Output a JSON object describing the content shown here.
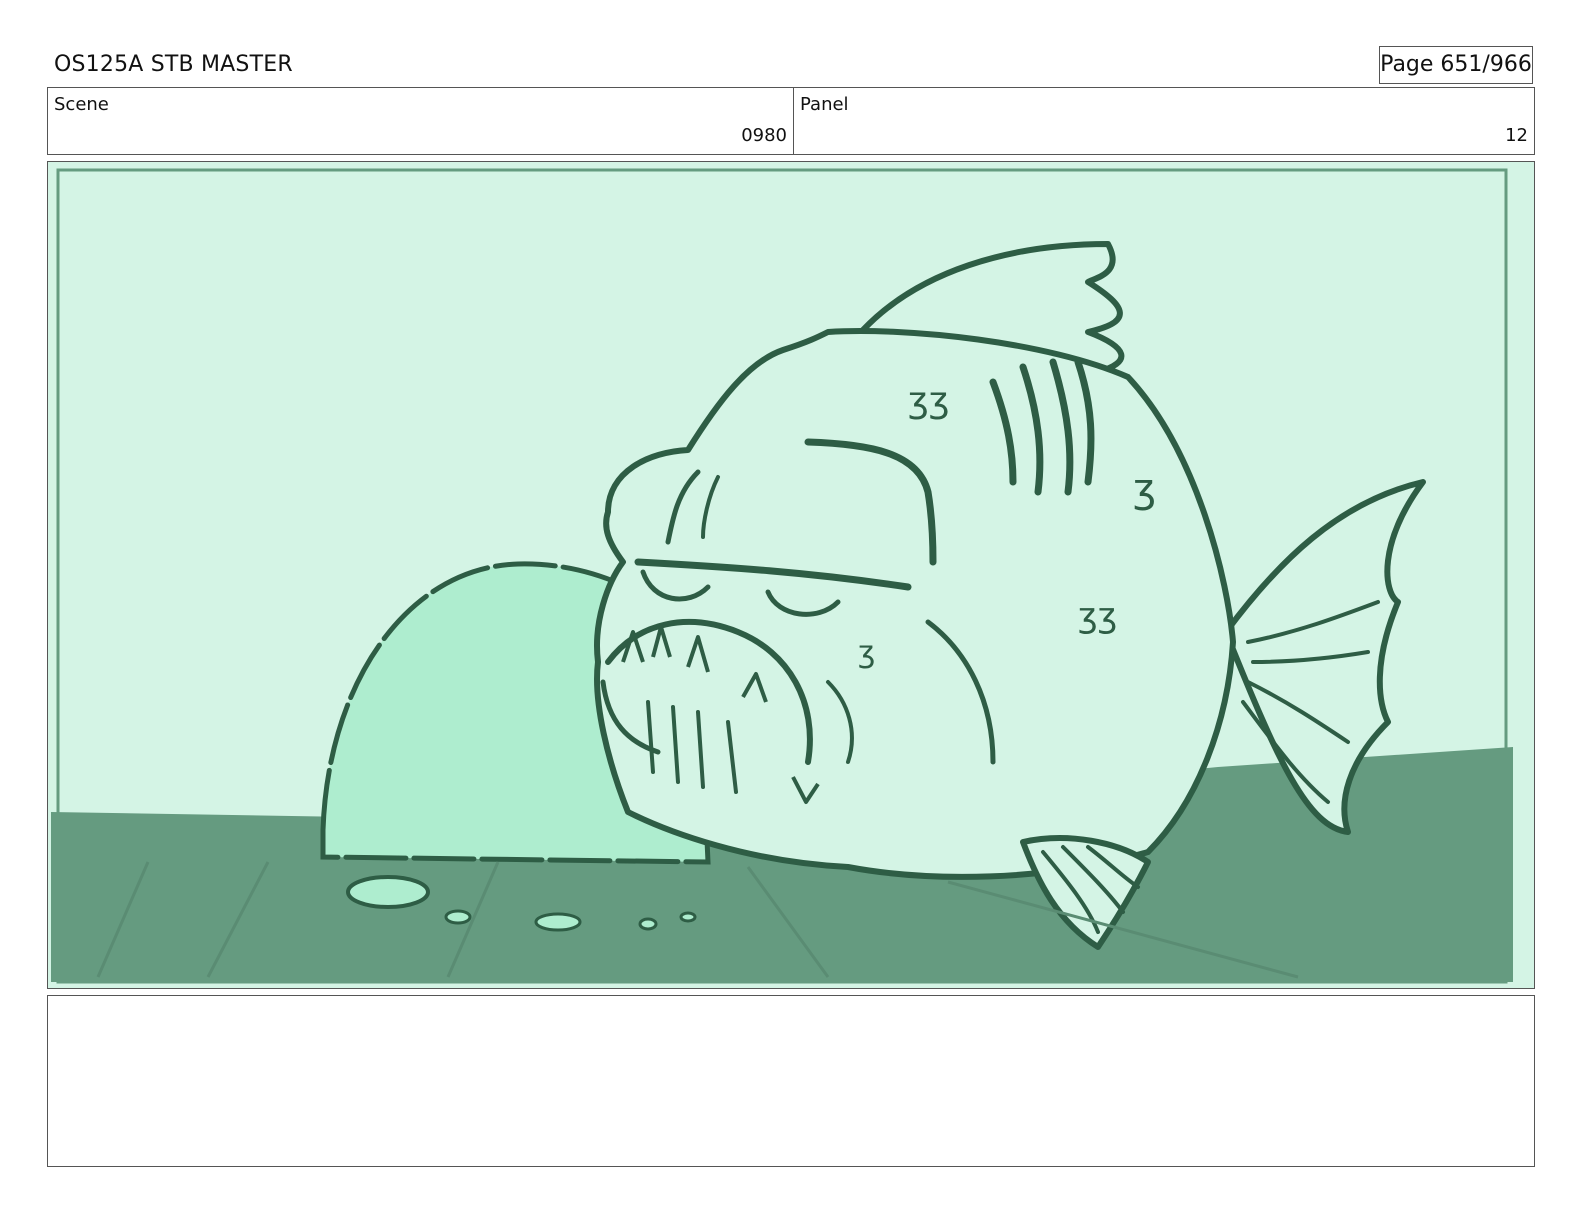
{
  "header": {
    "title": "OS125A STB MASTER",
    "page": "Page 651/966"
  },
  "info": {
    "scene_label": "Scene",
    "scene_value": "0980",
    "panel_label": "Panel",
    "panel_value": "12"
  },
  "artwork": {
    "icon": "fish-illustration",
    "colors": {
      "water": "#d4f4e5",
      "seabed": "#659b80",
      "rock": "#aeedcf",
      "fish_body": "#d4f4e5",
      "ink": "#2e5d45"
    }
  },
  "notes": {
    "text": ""
  }
}
